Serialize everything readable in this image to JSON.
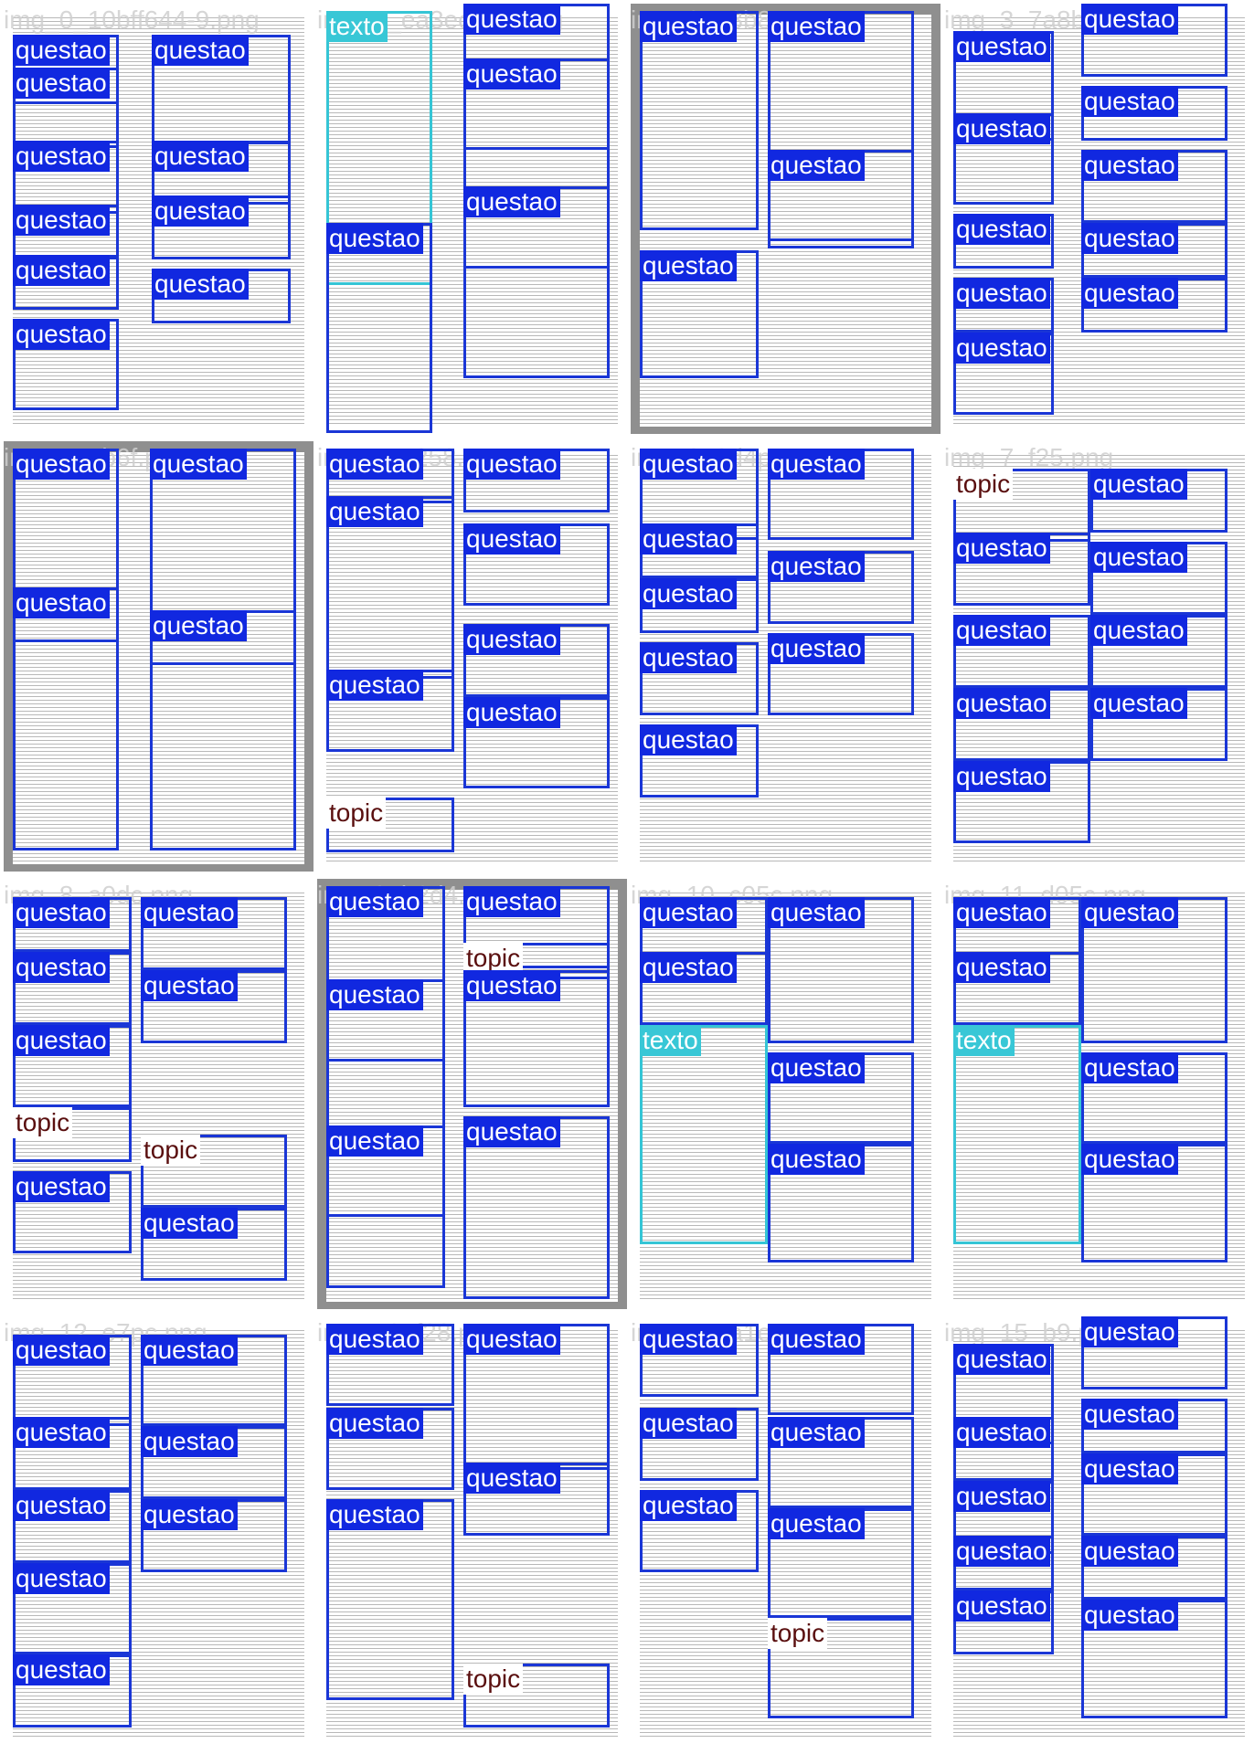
{
  "mosaic": {
    "tiles": [
      {
        "filename": "img_0_10bff644-9.png",
        "labels": [
          "questao",
          "questao",
          "questao",
          "questao",
          "questao",
          "questao",
          "questao",
          "questao",
          "questao",
          "questao"
        ]
      },
      {
        "filename": "img_1_ea3ec050.png",
        "labels": [
          "texto",
          "questao",
          "questao",
          "questao",
          "questao"
        ]
      },
      {
        "filename": "img_2_e3b845.png",
        "labels": [
          "questao",
          "questao",
          "questao",
          "questao"
        ]
      },
      {
        "filename": "img_3_7a8b6c.png",
        "labels": [
          "questao",
          "questao",
          "questao",
          "questao",
          "questao",
          "questao",
          "questao",
          "questao",
          "questao",
          "questao"
        ]
      },
      {
        "filename": "img_4_1b6f.png",
        "labels": [
          "questao",
          "questao",
          "questao",
          "questao"
        ]
      },
      {
        "filename": "img_5_c258.png",
        "labels": [
          "questao",
          "questao",
          "questao",
          "questao",
          "questao",
          "questao",
          "questao",
          "topic"
        ]
      },
      {
        "filename": "img_6_9d4pc.png",
        "labels": [
          "questao",
          "questao",
          "questao",
          "questao",
          "questao",
          "questao",
          "questao",
          "questao"
        ]
      },
      {
        "filename": "img_7_f25.png",
        "labels": [
          "topic",
          "questao",
          "questao",
          "questao",
          "questao",
          "questao",
          "questao",
          "questao",
          "questao"
        ]
      },
      {
        "filename": "img_8_a0dc.png",
        "labels": [
          "questao",
          "questao",
          "questao",
          "questao",
          "questao",
          "topic",
          "topic",
          "questao",
          "questao"
        ]
      },
      {
        "filename": "img_9_b2d4.png",
        "labels": [
          "questao",
          "questao",
          "topic",
          "questao",
          "questao",
          "questao",
          "questao"
        ]
      },
      {
        "filename": "img_10_c05c.png",
        "labels": [
          "questao",
          "questao",
          "questao",
          "texto",
          "questao",
          "questao"
        ]
      },
      {
        "filename": "img_11_d05c.png",
        "labels": [
          "questao",
          "questao",
          "questao",
          "texto",
          "questao",
          "questao"
        ]
      },
      {
        "filename": "img_12_e7pc.png",
        "labels": [
          "questao",
          "questao",
          "questao",
          "questao",
          "questao",
          "questao",
          "questao",
          "questao"
        ]
      },
      {
        "filename": "img_13_f28.png",
        "labels": [
          "questao",
          "questao",
          "questao",
          "questao",
          "questao",
          "topic"
        ]
      },
      {
        "filename": "img_14_a1e.png",
        "labels": [
          "questao",
          "questao",
          "questao",
          "questao",
          "questao",
          "questao",
          "topic"
        ]
      },
      {
        "filename": "img_15_b9.png",
        "labels": [
          "questao",
          "questao",
          "questao",
          "questao",
          "questao",
          "questao",
          "questao",
          "questao",
          "questao",
          "questao"
        ]
      }
    ]
  },
  "colors": {
    "questao": "#1128e0",
    "texto": "#38c7d6",
    "topic": "#5a0f0f"
  }
}
